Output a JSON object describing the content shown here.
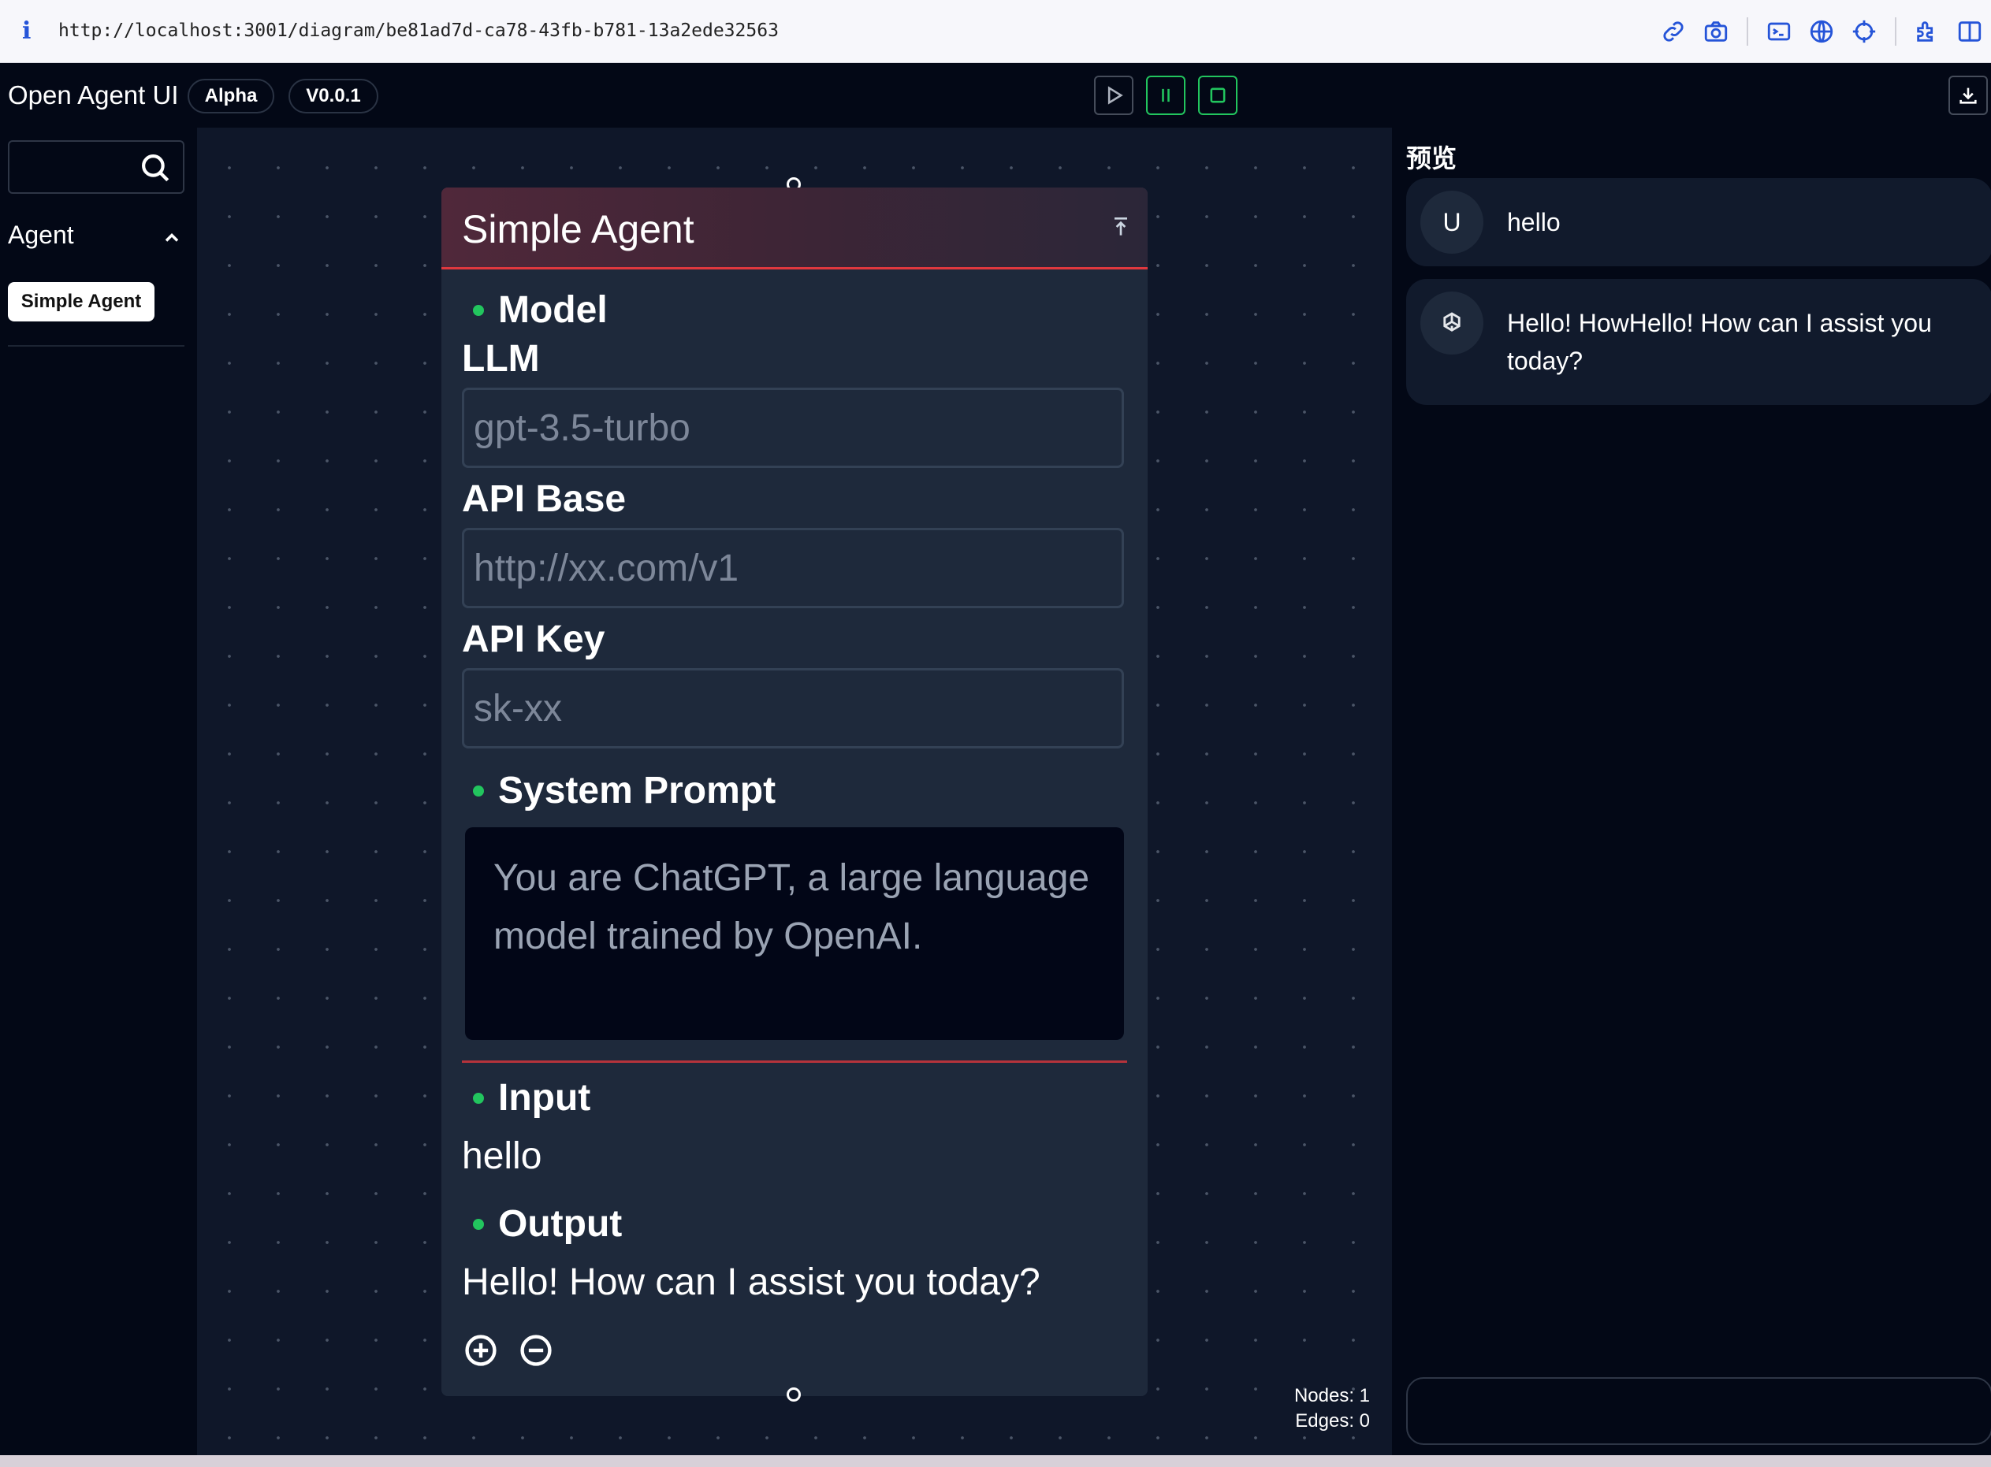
{
  "browser": {
    "info_glyph": "i",
    "url": "http://localhost:3001/diagram/be81ad7d-ca78-43fb-b781-13a2ede32563",
    "tool_icons": [
      "link-icon",
      "camera-icon",
      "terminal-icon",
      "globe-icon",
      "crosshair-icon",
      "extension-icon",
      "sidebar-toggle-icon"
    ]
  },
  "header": {
    "title": "Open Agent UI",
    "badge_stage": "Alpha",
    "badge_version": "V0.0.1",
    "controls": [
      "play-icon",
      "pause-icon",
      "stop-icon"
    ],
    "download_icon": "download-icon"
  },
  "sidebar": {
    "search": {
      "value": "",
      "placeholder": ""
    },
    "section_title": "Agent",
    "items": [
      {
        "label": "Simple Agent"
      }
    ]
  },
  "canvas": {
    "node": {
      "title": "Simple Agent",
      "model_section": "Model",
      "llm_label": "LLM",
      "llm_placeholder": "gpt-3.5-turbo",
      "api_base_label": "API Base",
      "api_base_placeholder": "http://xx.com/v1",
      "api_key_label": "API Key",
      "api_key_placeholder": "sk-xx",
      "system_prompt_section": "System Prompt",
      "system_prompt_value": "You are ChatGPT, a large language model trained by OpenAI.",
      "input_section": "Input",
      "input_value": "hello",
      "output_section": "Output",
      "output_value": "Hello! How can I assist you today?"
    },
    "stats": {
      "nodes": "Nodes: 1",
      "edges": "Edges: 0"
    }
  },
  "preview": {
    "title": "预览",
    "messages": [
      {
        "role": "user",
        "avatar": "U",
        "text": "hello"
      },
      {
        "role": "assistant",
        "avatar_icon": "openai-icon",
        "text": "Hello! HowHello! How can I assist you today?"
      }
    ],
    "input": {
      "value": "",
      "placeholder": ""
    }
  },
  "colors": {
    "accent_green": "#22c55e",
    "node_header_border": "#e0383e",
    "browser_icon_blue": "#2554d8",
    "canvas_bg": "#0f1729"
  }
}
